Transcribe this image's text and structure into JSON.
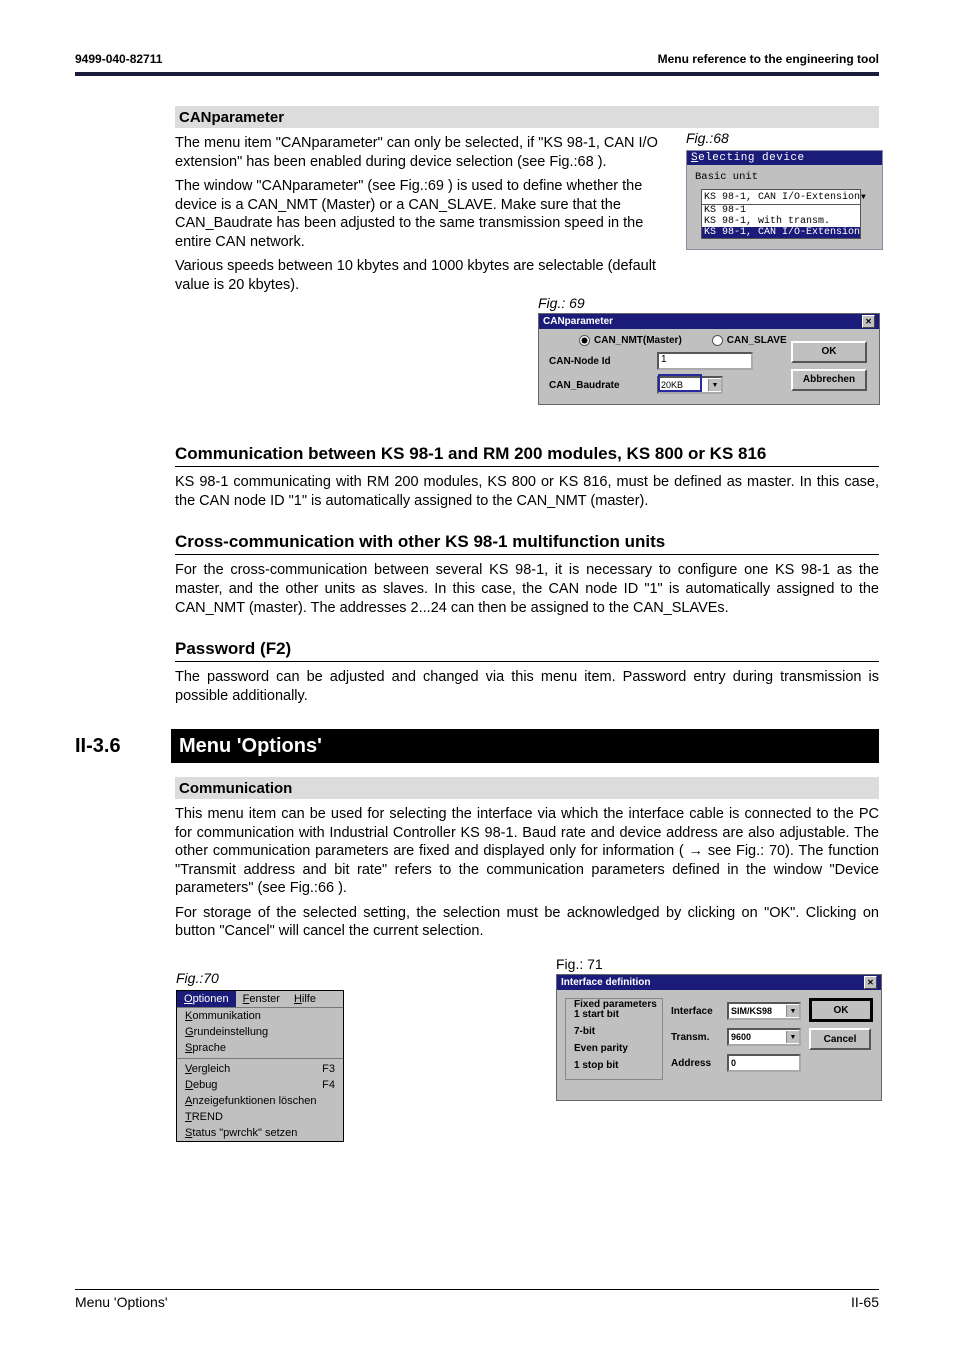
{
  "header": {
    "doc_id": "9499-040-82711",
    "ref": "Menu reference to the engineering tool"
  },
  "sec_canparam": {
    "title": "CANparameter",
    "p1": "The menu item \"CANparameter\" can only be selected, if \"KS 98-1, CAN I/O extension\" has been enabled during device selection (see Fig.:68 ).",
    "p2": "The window \"CANparameter\" (see Fig.:69 ) is used to define whether the device is a CAN_NMT (Master) or a CAN_SLAVE. Make sure that the CAN_Baudrate has been adjusted to the same transmission speed in the entire CAN network.",
    "p3": "Various speeds between 10 kbytes and 1000 kbytes are selectable (default value is 20 kbytes)."
  },
  "sec_commrm": {
    "title": "Communication between KS 98-1 and RM 200 modules, KS 800 or KS 816",
    "p1": "KS 98-1 communicating with RM 200 modules, KS 800 or KS 816, must be defined as master. In this case, the CAN node ID \"1\" is automatically assigned to the CAN_NMT (master)."
  },
  "sec_cross": {
    "title": "Cross-communication with other KS 98-1 multifunction units",
    "p1": "For the cross-communication between several KS 98-1, it is necessary to configure one KS 98-1 as the master, and the other units as slaves. In this case, the CAN node ID \"1\" is automatically assigned to the CAN_NMT (master). The addresses 2...24 can then be assigned to the CAN_SLAVEs."
  },
  "sec_pw": {
    "title": "Password (F2)",
    "p1": "The password can be adjusted and changed via this menu item. Password entry during transmission is possible additionally."
  },
  "chapter": {
    "num": "II-3.6",
    "title": "Menu 'Options'"
  },
  "sec_comm": {
    "title": "Communication",
    "p1": "This menu item can be used for selecting the interface via which the interface cable is connected to the PC for communication with Industrial Controller KS 98-1. Baud rate and device address are also adjustable. The other communication parameters are fixed and displayed only for information ( → see Fig.: 70). The function \"Transmit address and bit rate\" refers to the communication parameters defined in the window \"Device parameters\" (see Fig.:66 ).",
    "p2": "For storage of the selected setting, the selection must be acknowledged by clicking on \"OK\". Clicking on button \"Cancel\" will cancel the current selection."
  },
  "fig68": {
    "label": "Fig.:68",
    "title_pre": "S",
    "title_rest": "electing device",
    "group": "Basic unit",
    "combo_selected": "KS 98-1, CAN I/O-Extension",
    "list": [
      "KS 98-1",
      "KS 98-1, with transm.",
      "KS 98-1, CAN I/O-Extension"
    ],
    "list_selected_index": 2
  },
  "fig69": {
    "label": "Fig.: 69",
    "title": "CANparameter",
    "radio1": "CAN_NMT(Master)",
    "radio2": "CAN_SLAVE",
    "lbl_node": "CAN-Node Id",
    "node_val": "1",
    "lbl_baud": "CAN_Baudrate",
    "baud_val": "20KB",
    "btn_ok": "OK",
    "btn_cancel": "Abbrechen"
  },
  "fig70": {
    "label": "Fig.:70",
    "menubar": {
      "m1": "Optionen",
      "m2": "Fenster",
      "m3": "Hilfe"
    },
    "items": [
      "Kommunikation",
      "Grundeinstellung",
      "Sprache",
      "-",
      "Vergleich|F3",
      "Debug|F4",
      "Anzeigefunktionen löschen",
      "TREND",
      "Status \"pwrchk\" setzen"
    ]
  },
  "fig71": {
    "label": "Fig.: 71",
    "title": "Interface definition",
    "fixed_title": "Fixed parameters",
    "fixed": [
      "1 start bit",
      "7-bit",
      "Even parity",
      "1 stop bit"
    ],
    "lbl_if": "Interface",
    "if_val": "SIM/KS98",
    "lbl_tx": "Transm.",
    "tx_val": "9600",
    "lbl_addr": "Address",
    "addr_val": "0",
    "btn_ok": "OK",
    "btn_cancel": "Cancel"
  },
  "footer": {
    "left": "Menu 'Options'",
    "right": "II-65"
  }
}
